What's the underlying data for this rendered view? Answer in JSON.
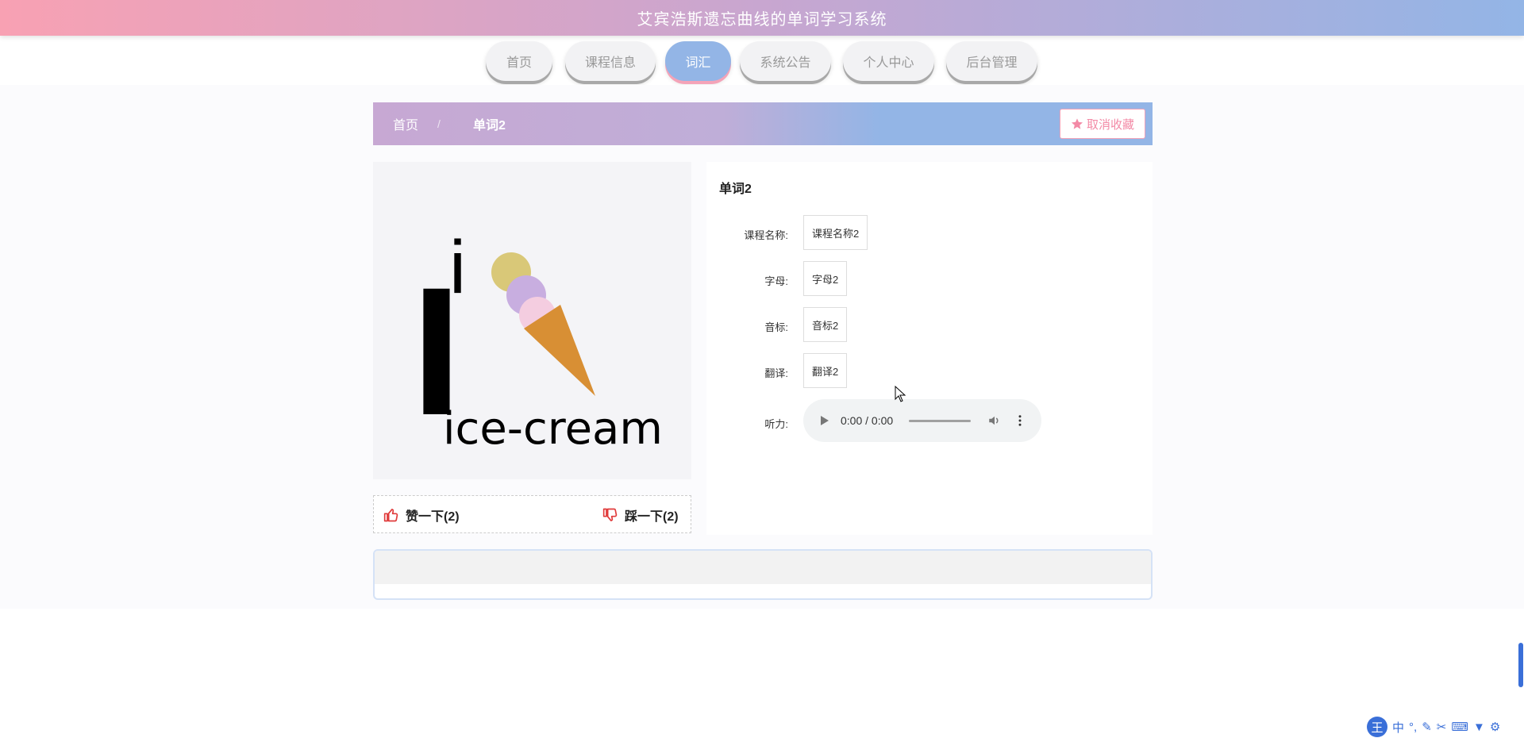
{
  "header": {
    "title": "艾宾浩斯遗忘曲线的单词学习系统"
  },
  "nav": {
    "items": [
      {
        "label": "首页"
      },
      {
        "label": "课程信息"
      },
      {
        "label": "词汇"
      },
      {
        "label": "系统公告"
      },
      {
        "label": "个人中心"
      },
      {
        "label": "后台管理"
      }
    ],
    "active": "词汇"
  },
  "breadcrumb": {
    "home": "首页",
    "separator": "/",
    "current": "单词2"
  },
  "favorite_button": {
    "label": "取消收藏",
    "icon": "star-icon"
  },
  "word": {
    "title": "单词2",
    "image_text": "ice-cream",
    "image_letter": "I",
    "image_small_letter": "i",
    "fields": [
      {
        "label": "课程名称:",
        "value": "课程名称2"
      },
      {
        "label": "字母:",
        "value": "字母2"
      },
      {
        "label": "音标:",
        "value": "音标2"
      },
      {
        "label": "翻译:",
        "value": "翻译2"
      }
    ],
    "audio_label": "听力:",
    "audio_time": "0:00 / 0:00"
  },
  "votes": {
    "like": "赞一下(2)",
    "dislike": "踩一下(2)"
  },
  "colors": {
    "accent_blue": "#93b5e6",
    "accent_pink": "#f4a3b8",
    "vote_red": "#e03b3b"
  },
  "ime": {
    "logo": "王",
    "mode": "中"
  }
}
